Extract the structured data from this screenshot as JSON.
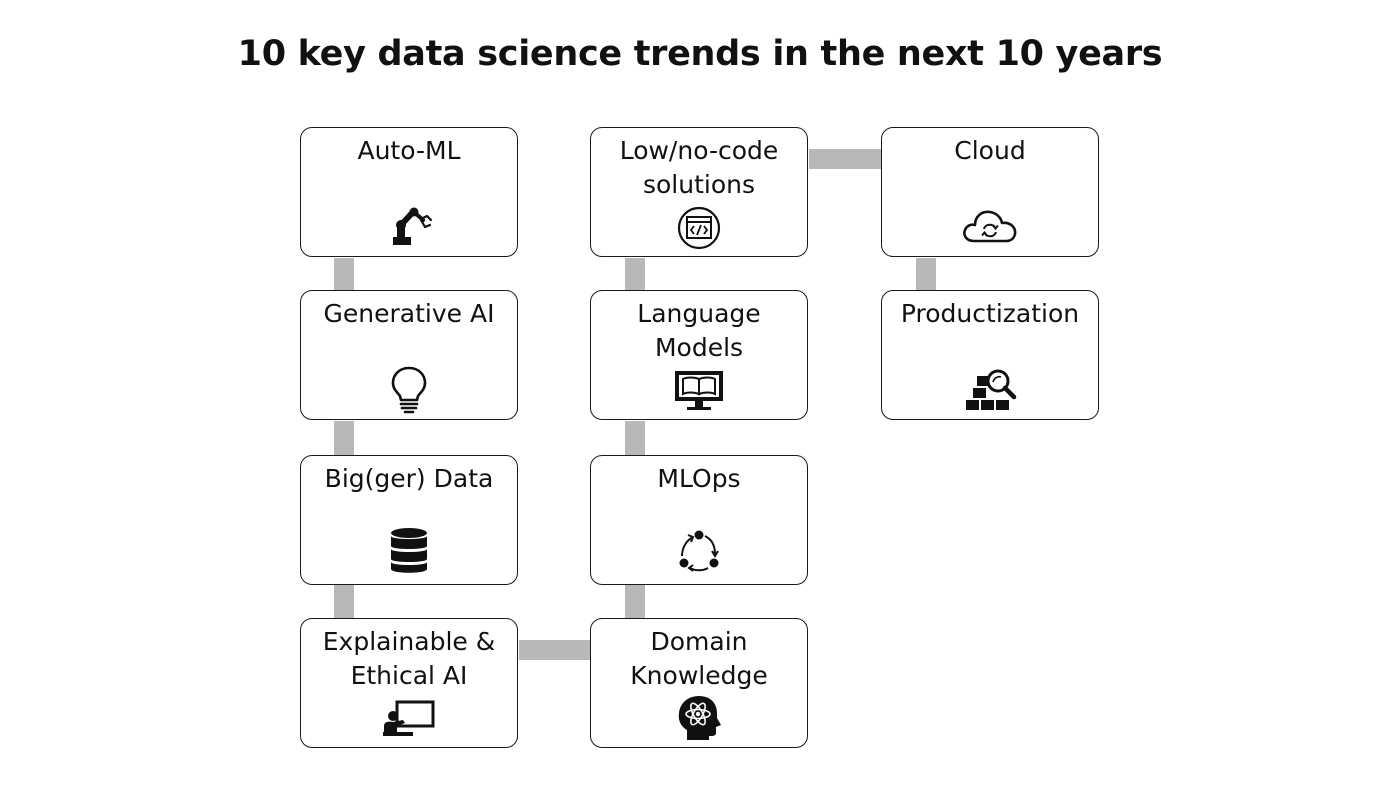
{
  "title": "10 key data science trends in the next 10 years",
  "colors": {
    "connector": "#b8b8b8",
    "border": "#1a1a1a",
    "text": "#111111"
  },
  "boxes": [
    {
      "label": "Auto-ML",
      "icon": "robot-arm-icon"
    },
    {
      "label": "Generative AI",
      "icon": "lightbulb-icon"
    },
    {
      "label": "Big(ger) Data",
      "icon": "database-icon"
    },
    {
      "label": "Explainable &\nEthical AI",
      "icon": "presentation-board-icon"
    },
    {
      "label": "Low/no-code\nsolutions",
      "icon": "code-window-icon"
    },
    {
      "label": "Language\nModels",
      "icon": "book-monitor-icon"
    },
    {
      "label": "MLOps",
      "icon": "cycle-arrows-icon"
    },
    {
      "label": "Domain\nKnowledge",
      "icon": "atom-head-icon"
    },
    {
      "label": "Cloud",
      "icon": "cloud-sync-icon"
    },
    {
      "label": "Productization",
      "icon": "boxes-magnifier-icon"
    }
  ]
}
